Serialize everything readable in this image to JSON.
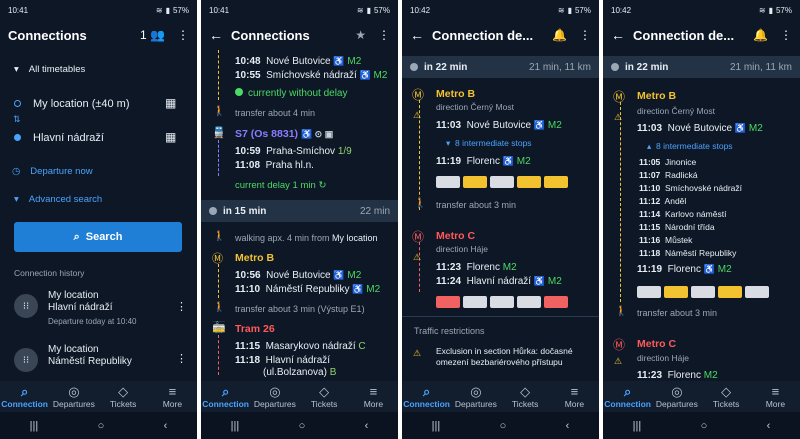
{
  "status": {
    "p1_time": "10:41",
    "p2_time": "10:41",
    "p3_time": "10:42",
    "p4_time": "10:42",
    "battery": "57%"
  },
  "screen1": {
    "title": "Connections",
    "count_badge": "1",
    "all_timetables": "All timetables",
    "from": "My location (±40 m)",
    "to": "Hlavní nádraží",
    "departure": "Departure now",
    "advanced": "Advanced search",
    "search": "Search",
    "history_header": "Connection history",
    "history": [
      {
        "line1": "My location",
        "line2": "Hlavní nádraží",
        "line3": "Departure today at 10:40"
      },
      {
        "line1": "My location",
        "line2": "Náměstí Republiky",
        "line3": ""
      }
    ]
  },
  "screen2": {
    "title": "Connections",
    "r1_time": "10:48",
    "r1_stop": "Nové Butovice",
    "r2_time": "10:55",
    "r2_stop": "Smíchovské nádraží",
    "m2": "M2",
    "no_delay": "currently without delay",
    "transfer1": "transfer about 4 min",
    "train": "S7 (Os 8831)",
    "t1_time": "10:59",
    "t1_stop": "Praha-Smíchov",
    "t1_plat": "1/9",
    "t2_time": "11:08",
    "t2_stop": "Praha hl.n.",
    "delay": "current delay 1 min",
    "band_left": "in 15 min",
    "band_right": "22 min",
    "walk_prefix": "walking apx. 4 min from ",
    "walk_from": "My location",
    "metro": "Metro B",
    "m1_time": "10:56",
    "m1_stop": "Nové Butovice",
    "m2_time": "11:10",
    "m2_stop": "Náměstí Republiky",
    "transfer2": "transfer about 3 min (Výstup E1)",
    "tram": "Tram 26",
    "tr1_time": "11:15",
    "tr1_stop": "Masarykovo nádraží",
    "tr1_plat": "C",
    "tr2_time": "11:18",
    "tr2_stop": "Hlavní nádraží",
    "tr2_sub": "(ul.Bolzanova)",
    "tr2_plat": "B"
  },
  "screen3": {
    "title": "Connection de...",
    "band_left": "in 22 min",
    "band_right": "21 min, 11 km",
    "metro_b": "Metro B",
    "dir_b": "direction Černý Most",
    "b1_time": "11:03",
    "b1_stop": "Nové Butovice",
    "intermediate": "8 intermediate stops",
    "b2_time": "11:19",
    "b2_stop": "Florenc",
    "transfer": "transfer about 3 min",
    "metro_c": "Metro C",
    "dir_c": "direction Háje",
    "c1_time": "11:23",
    "c1_stop": "Florenc",
    "c2_time": "11:24",
    "c2_stop": "Hlavní nádraží",
    "m2": "M2",
    "restrictions": "Traffic restrictions",
    "exclusion": "Exclusion in section Hůrka: dočasné omezení bezbariérového přístupu"
  },
  "screen4": {
    "title": "Connection de...",
    "band_left": "in 22 min",
    "band_right": "21 min, 11 km",
    "metro_b": "Metro B",
    "dir_b": "direction Černý Most",
    "b1_time": "11:03",
    "b1_stop": "Nové Butovice",
    "intermediate": "8 intermediate stops",
    "stops": [
      {
        "time": "11:05",
        "name": "Jinonice"
      },
      {
        "time": "11:07",
        "name": "Radlická"
      },
      {
        "time": "11:10",
        "name": "Smíchovské nádraží"
      },
      {
        "time": "11:12",
        "name": "Anděl"
      },
      {
        "time": "11:14",
        "name": "Karlovo náměstí"
      },
      {
        "time": "11:15",
        "name": "Národní třída"
      },
      {
        "time": "11:16",
        "name": "Můstek"
      },
      {
        "time": "11:18",
        "name": "Náměstí Republiky"
      }
    ],
    "b2_time": "11:19",
    "b2_stop": "Florenc",
    "transfer": "transfer about 3 min",
    "metro_c": "Metro C",
    "dir_c": "direction Háje",
    "c1_time": "11:23",
    "c1_stop": "Florenc",
    "m2": "M2"
  },
  "nav": {
    "connection": "Connection",
    "departures": "Departures",
    "tickets": "Tickets",
    "more": "More"
  },
  "colors": {
    "background": "#0e1726",
    "accent": "#4aa3ff",
    "button": "#1f7fd6",
    "delay_green": "#4cd964",
    "metro_b": "#f2c230",
    "metro_c": "#f06262",
    "train": "#8b7dff"
  }
}
